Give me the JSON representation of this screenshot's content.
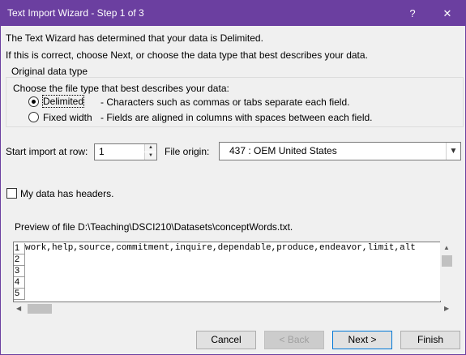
{
  "window": {
    "title": "Text Import Wizard - Step 1 of 3",
    "help_glyph": "?",
    "close_glyph": "✕",
    "accent": "#6b3fa0"
  },
  "intro": {
    "line1": "The Text Wizard has determined that your data is Delimited.",
    "line2": "If this is correct, choose Next, or choose the data type that best describes your data."
  },
  "data_type": {
    "group_label": "Original data type",
    "prompt": "Choose the file type that best describes your data:",
    "options": [
      {
        "label": "Delimited",
        "description": "- Characters such as commas or tabs separate each field.",
        "selected": true
      },
      {
        "label": "Fixed width",
        "description": "- Fields are aligned in columns with spaces between each field.",
        "selected": false
      }
    ]
  },
  "import": {
    "start_row_label": "Start import at row:",
    "start_row_value": "1",
    "file_origin_label": "File origin:",
    "file_origin_value": "437 : OEM United States"
  },
  "headers_checkbox": {
    "label": "My data has headers.",
    "checked": false
  },
  "preview": {
    "label": "Preview of file D:\\Teaching\\DSCI210\\Datasets\\conceptWords.txt.",
    "rows": [
      {
        "num": "1",
        "text": "work,help,source,commitment,inquire,dependable,produce,endeavor,limit,alt"
      },
      {
        "num": "2",
        "text": ""
      },
      {
        "num": "3",
        "text": ""
      },
      {
        "num": "4",
        "text": ""
      },
      {
        "num": "5",
        "text": ""
      }
    ]
  },
  "buttons": {
    "cancel": "Cancel",
    "back": "< Back",
    "next": "Next >",
    "finish": "Finish"
  }
}
